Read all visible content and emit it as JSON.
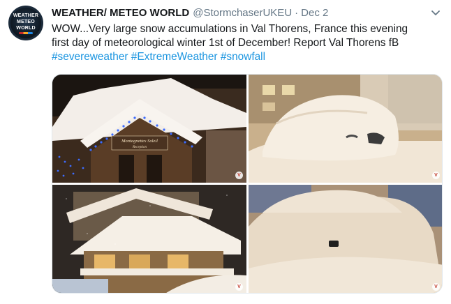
{
  "tweet": {
    "avatar": {
      "lines": [
        "WEATHER",
        "METEO",
        "WORLD"
      ]
    },
    "author": "WEATHER/ METEO WORLD",
    "handle": "@StormchaserUKEU",
    "separator": "·",
    "date": "Dec 2",
    "caret_icon": "chevron-down-icon",
    "text_lines": [
      "WOW...Very large snow accumulations in Val Thorens, France this evening",
      "first day of meteorological winter 1st of December! Report Val Thorens fB"
    ],
    "hashtags": [
      "#severeweather",
      "#ExtremeWeather",
      "#snowfall"
    ],
    "photos": [
      {
        "name": "photo-chalet-entrance-lights",
        "sign_line1": "Montagnettes Soleil",
        "sign_line2": "Reception"
      },
      {
        "name": "photo-snow-buried-car-1"
      },
      {
        "name": "photo-snow-covered-chalet"
      },
      {
        "name": "photo-snow-buried-car-2"
      }
    ],
    "watermark": "V",
    "colors": {
      "link": "#1b95e0",
      "text": "#14171a",
      "muted": "#657786",
      "border": "#e1e8ed"
    }
  }
}
